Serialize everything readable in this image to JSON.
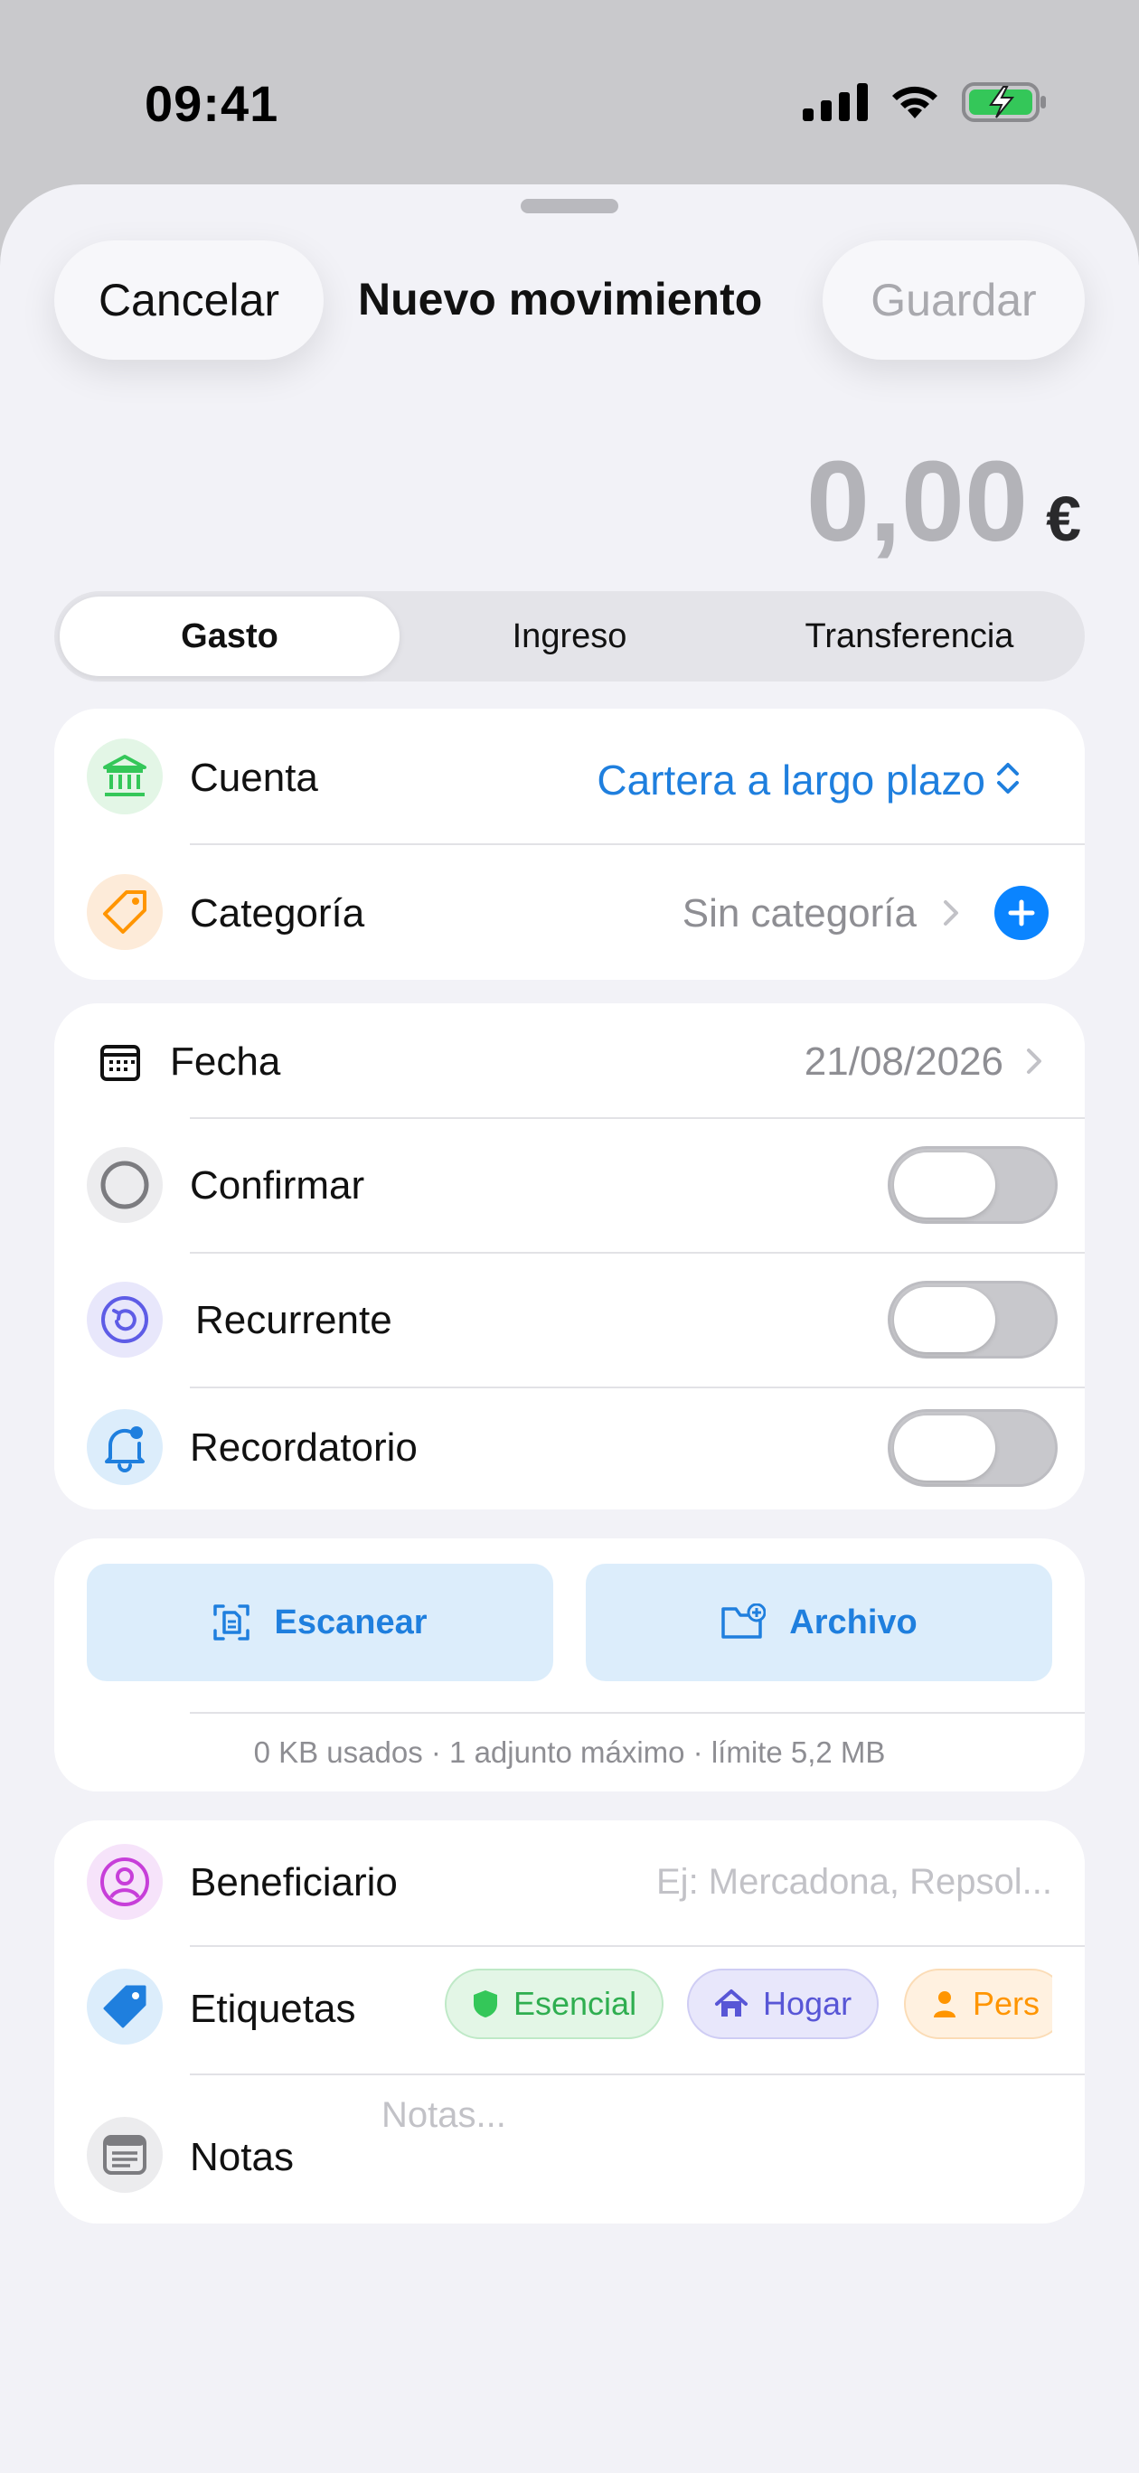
{
  "status_bar": {
    "time": "09:41"
  },
  "header": {
    "cancel_label": "Cancelar",
    "title": "Nuevo movimiento",
    "save_label": "Guardar"
  },
  "amount": {
    "value": "0,00",
    "currency": "€"
  },
  "type_segment": {
    "options": [
      "Gasto",
      "Ingreso",
      "Transferencia"
    ],
    "selected": "Gasto"
  },
  "account_card": {
    "account_label": "Cuenta",
    "account_value": "Cartera a largo plazo",
    "category_label": "Categoría",
    "category_value": "Sin categoría"
  },
  "schedule_card": {
    "date_label": "Fecha",
    "date_value": "21/08/2026",
    "confirm_label": "Confirmar",
    "confirm_on": false,
    "recurring_label": "Recurrente",
    "recurring_on": false,
    "reminder_label": "Recordatorio",
    "reminder_on": false
  },
  "attachments": {
    "scan_label": "Escanear",
    "file_label": "Archivo",
    "info": "0 KB usados · 1 adjunto máximo · límite 5,2 MB"
  },
  "details_card": {
    "payee_label": "Beneficiario",
    "payee_placeholder": "Ej: Mercadona, Repsol...",
    "tags_label": "Etiquetas",
    "tags": [
      {
        "label": "Esencial",
        "icon": "shield-icon",
        "color": "#34c759"
      },
      {
        "label": "Hogar",
        "icon": "house-icon",
        "color": "#5856d6"
      },
      {
        "label": "Pers",
        "icon": "person-icon",
        "color": "#ff9500"
      }
    ],
    "notes_label": "Notas",
    "notes_placeholder": "Notas..."
  },
  "colors": {
    "accent_blue": "#1f7fde",
    "sheet_bg": "#f2f2f7",
    "account_icon_green": "#34c759",
    "category_icon_orange": "#ff9500",
    "recurring_purple": "#5e5ce6",
    "payee_magenta": "#c73fd9"
  }
}
